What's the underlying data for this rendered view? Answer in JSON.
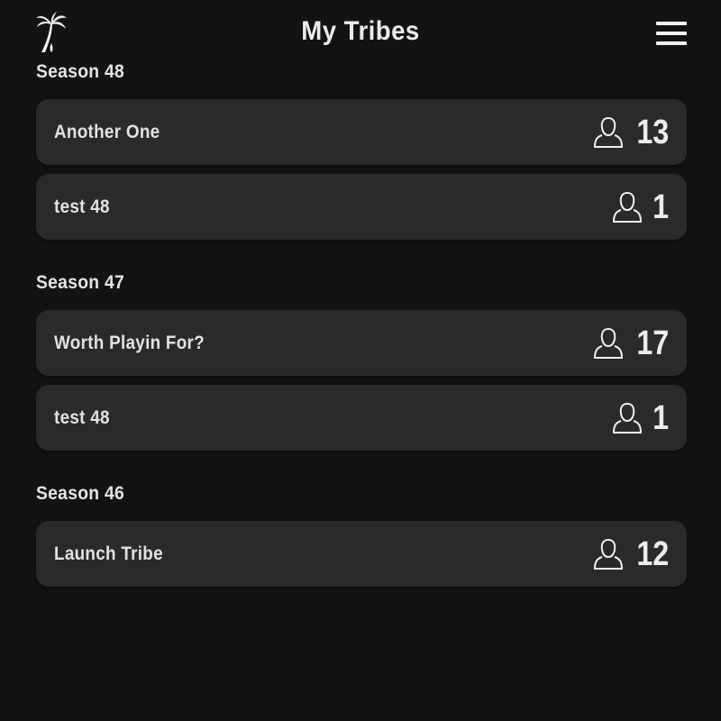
{
  "header": {
    "title": "My Tribes",
    "logo_icon": "palm-tree-icon",
    "menu_icon": "hamburger-menu-icon"
  },
  "seasons": [
    {
      "label": "Season 48",
      "tribes": [
        {
          "name": "Another One",
          "members": "13"
        },
        {
          "name": "test 48",
          "members": "1"
        }
      ]
    },
    {
      "label": "Season 47",
      "tribes": [
        {
          "name": "Worth Playin For?",
          "members": "17"
        },
        {
          "name": "test 48",
          "members": "1"
        }
      ]
    },
    {
      "label": "Season 46",
      "tribes": [
        {
          "name": "Launch Tribe",
          "members": "12"
        }
      ]
    }
  ],
  "colors": {
    "background": "#131313",
    "card": "#2a2a2a",
    "text": "#e6e6e6"
  }
}
